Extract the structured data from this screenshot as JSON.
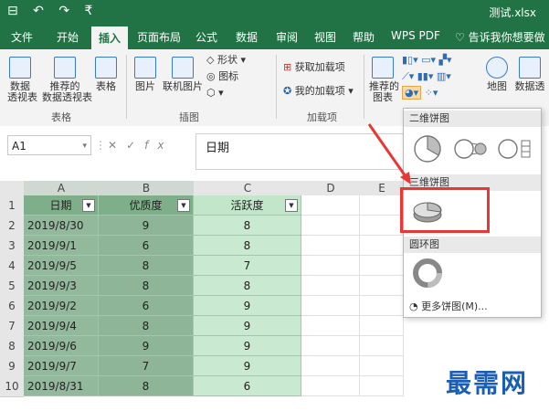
{
  "title_bar": {
    "quick_access": "⊟ ↶ ↷ ₹",
    "file_name": "测试.xlsx"
  },
  "menu": {
    "tabs": [
      "文件",
      "开始",
      "插入",
      "页面布局",
      "公式",
      "数据",
      "审阅",
      "视图",
      "帮助",
      "WPS PDF",
      "告诉我你想要做"
    ],
    "active": "插入"
  },
  "ribbon": {
    "pivot": "数据\n透视表",
    "rec_pivot": "推荐的\n数据透视表",
    "table": "表格",
    "group_table": "表格",
    "picture": "图片",
    "online_picture": "联机图片",
    "shapes": "形状",
    "icons": "图标",
    "group_illustrations": "插图",
    "get_addins": "获取加载项",
    "my_addins": "我的加载项",
    "group_addins": "加载项",
    "rec_charts": "推荐的\n图表",
    "map": "地图",
    "data_pivot_chart": "数据透"
  },
  "formula_bar": {
    "name_box": "A1",
    "fx": "fx",
    "content": "日期"
  },
  "columns": [
    "A",
    "B",
    "C",
    "D",
    "E"
  ],
  "rows": [
    "1",
    "2",
    "3",
    "4",
    "5",
    "6",
    "7",
    "8",
    "9",
    "10"
  ],
  "table": {
    "headers": [
      "日期",
      "优质度",
      "活跃度"
    ],
    "data": [
      [
        "2019/8/30",
        "9",
        "8"
      ],
      [
        "2019/9/1",
        "6",
        "8"
      ],
      [
        "2019/9/5",
        "8",
        "7"
      ],
      [
        "2019/9/3",
        "8",
        "8"
      ],
      [
        "2019/9/2",
        "6",
        "9"
      ],
      [
        "2019/9/4",
        "8",
        "9"
      ],
      [
        "2019/9/6",
        "9",
        "9"
      ],
      [
        "2019/9/7",
        "7",
        "9"
      ],
      [
        "2019/8/31",
        "8",
        "6"
      ]
    ]
  },
  "pie_menu": {
    "section_2d": "二维饼图",
    "section_3d": "三维饼图",
    "section_donut": "圆环图",
    "more": "更多饼图(M)..."
  },
  "watermark": "最需网",
  "colors": {
    "ribbon_green": "#217346",
    "highlight_red": "#e53935",
    "watermark_blue": "#1a5fb4"
  }
}
